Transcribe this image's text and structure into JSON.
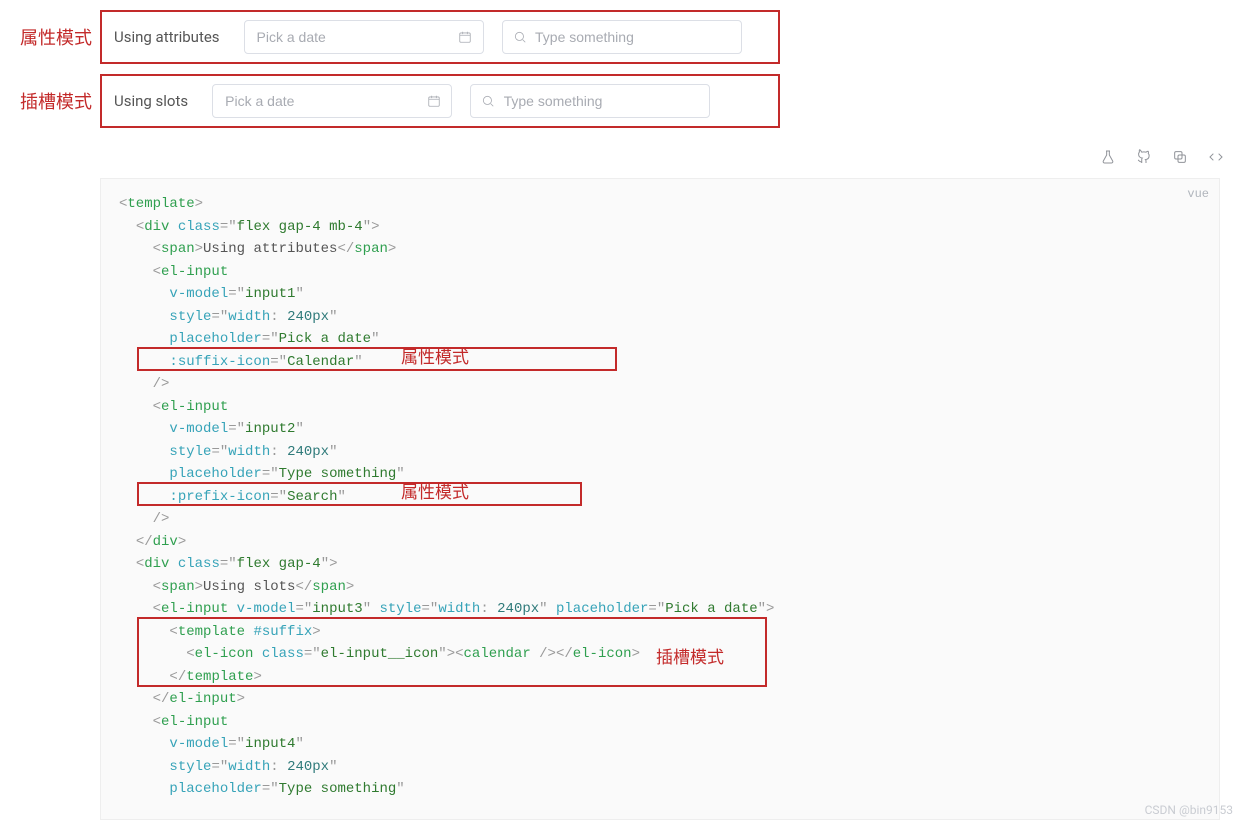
{
  "demo": {
    "row1": {
      "cn_label": "属性模式",
      "en_label": "Using attributes",
      "input1_placeholder": "Pick a date",
      "input2_placeholder": "Type something"
    },
    "row2": {
      "cn_label": "插槽模式",
      "en_label": "Using slots",
      "input1_placeholder": "Pick a date",
      "input2_placeholder": "Type something"
    }
  },
  "toolbar": {
    "lang_label": "vue"
  },
  "annotations": {
    "attr_mode_1": "属性模式",
    "attr_mode_2": "属性模式",
    "slot_mode": "插槽模式"
  },
  "watermark": "CSDN @bin9153",
  "code_lines": [
    {
      "indent": 0,
      "tokens": [
        {
          "c": "p",
          "v": "<"
        },
        {
          "c": "t",
          "v": "template"
        },
        {
          "c": "p",
          "v": ">"
        }
      ]
    },
    {
      "indent": 1,
      "tokens": [
        {
          "c": "p",
          "v": "<"
        },
        {
          "c": "t",
          "v": "div"
        },
        {
          "c": "p",
          "v": " "
        },
        {
          "c": "a",
          "v": "class"
        },
        {
          "c": "p",
          "v": "="
        },
        {
          "c": "p",
          "v": "\""
        },
        {
          "c": "s",
          "v": "flex gap-4 mb-4"
        },
        {
          "c": "p",
          "v": "\""
        },
        {
          "c": "p",
          "v": ">"
        }
      ]
    },
    {
      "indent": 2,
      "tokens": [
        {
          "c": "p",
          "v": "<"
        },
        {
          "c": "t",
          "v": "span"
        },
        {
          "c": "p",
          "v": ">"
        },
        {
          "c": "tx",
          "v": "Using attributes"
        },
        {
          "c": "p",
          "v": "</"
        },
        {
          "c": "t",
          "v": "span"
        },
        {
          "c": "p",
          "v": ">"
        }
      ]
    },
    {
      "indent": 2,
      "tokens": [
        {
          "c": "p",
          "v": "<"
        },
        {
          "c": "t",
          "v": "el-input"
        }
      ]
    },
    {
      "indent": 3,
      "tokens": [
        {
          "c": "a",
          "v": "v-model"
        },
        {
          "c": "p",
          "v": "="
        },
        {
          "c": "p",
          "v": "\""
        },
        {
          "c": "s",
          "v": "input1"
        },
        {
          "c": "p",
          "v": "\""
        }
      ]
    },
    {
      "indent": 3,
      "tokens": [
        {
          "c": "a",
          "v": "style"
        },
        {
          "c": "p",
          "v": "="
        },
        {
          "c": "p",
          "v": "\""
        },
        {
          "c": "a",
          "v": "width"
        },
        {
          "c": "p",
          "v": ":"
        },
        {
          "c": "tx",
          "v": " "
        },
        {
          "c": "n",
          "v": "240px"
        },
        {
          "c": "p",
          "v": "\""
        }
      ]
    },
    {
      "indent": 3,
      "tokens": [
        {
          "c": "a",
          "v": "placeholder"
        },
        {
          "c": "p",
          "v": "="
        },
        {
          "c": "p",
          "v": "\""
        },
        {
          "c": "s",
          "v": "Pick a date"
        },
        {
          "c": "p",
          "v": "\""
        }
      ]
    },
    {
      "indent": 3,
      "tokens": [
        {
          "c": "a",
          "v": ":suffix-icon"
        },
        {
          "c": "p",
          "v": "="
        },
        {
          "c": "p",
          "v": "\""
        },
        {
          "c": "s",
          "v": "Calendar"
        },
        {
          "c": "p",
          "v": "\""
        }
      ]
    },
    {
      "indent": 2,
      "tokens": [
        {
          "c": "p",
          "v": "/>"
        }
      ]
    },
    {
      "indent": 2,
      "tokens": [
        {
          "c": "p",
          "v": "<"
        },
        {
          "c": "t",
          "v": "el-input"
        }
      ]
    },
    {
      "indent": 3,
      "tokens": [
        {
          "c": "a",
          "v": "v-model"
        },
        {
          "c": "p",
          "v": "="
        },
        {
          "c": "p",
          "v": "\""
        },
        {
          "c": "s",
          "v": "input2"
        },
        {
          "c": "p",
          "v": "\""
        }
      ]
    },
    {
      "indent": 3,
      "tokens": [
        {
          "c": "a",
          "v": "style"
        },
        {
          "c": "p",
          "v": "="
        },
        {
          "c": "p",
          "v": "\""
        },
        {
          "c": "a",
          "v": "width"
        },
        {
          "c": "p",
          "v": ":"
        },
        {
          "c": "tx",
          "v": " "
        },
        {
          "c": "n",
          "v": "240px"
        },
        {
          "c": "p",
          "v": "\""
        }
      ]
    },
    {
      "indent": 3,
      "tokens": [
        {
          "c": "a",
          "v": "placeholder"
        },
        {
          "c": "p",
          "v": "="
        },
        {
          "c": "p",
          "v": "\""
        },
        {
          "c": "s",
          "v": "Type something"
        },
        {
          "c": "p",
          "v": "\""
        }
      ]
    },
    {
      "indent": 3,
      "tokens": [
        {
          "c": "a",
          "v": ":prefix-icon"
        },
        {
          "c": "p",
          "v": "="
        },
        {
          "c": "p",
          "v": "\""
        },
        {
          "c": "s",
          "v": "Search"
        },
        {
          "c": "p",
          "v": "\""
        }
      ]
    },
    {
      "indent": 2,
      "tokens": [
        {
          "c": "p",
          "v": "/>"
        }
      ]
    },
    {
      "indent": 1,
      "tokens": [
        {
          "c": "p",
          "v": "</"
        },
        {
          "c": "t",
          "v": "div"
        },
        {
          "c": "p",
          "v": ">"
        }
      ]
    },
    {
      "indent": 1,
      "tokens": [
        {
          "c": "p",
          "v": "<"
        },
        {
          "c": "t",
          "v": "div"
        },
        {
          "c": "p",
          "v": " "
        },
        {
          "c": "a",
          "v": "class"
        },
        {
          "c": "p",
          "v": "="
        },
        {
          "c": "p",
          "v": "\""
        },
        {
          "c": "s",
          "v": "flex gap-4"
        },
        {
          "c": "p",
          "v": "\""
        },
        {
          "c": "p",
          "v": ">"
        }
      ]
    },
    {
      "indent": 2,
      "tokens": [
        {
          "c": "p",
          "v": "<"
        },
        {
          "c": "t",
          "v": "span"
        },
        {
          "c": "p",
          "v": ">"
        },
        {
          "c": "tx",
          "v": "Using slots"
        },
        {
          "c": "p",
          "v": "</"
        },
        {
          "c": "t",
          "v": "span"
        },
        {
          "c": "p",
          "v": ">"
        }
      ]
    },
    {
      "indent": 2,
      "tokens": [
        {
          "c": "p",
          "v": "<"
        },
        {
          "c": "t",
          "v": "el-input"
        },
        {
          "c": "p",
          "v": " "
        },
        {
          "c": "a",
          "v": "v-model"
        },
        {
          "c": "p",
          "v": "="
        },
        {
          "c": "p",
          "v": "\""
        },
        {
          "c": "s",
          "v": "input3"
        },
        {
          "c": "p",
          "v": "\""
        },
        {
          "c": "p",
          "v": " "
        },
        {
          "c": "a",
          "v": "style"
        },
        {
          "c": "p",
          "v": "="
        },
        {
          "c": "p",
          "v": "\""
        },
        {
          "c": "a",
          "v": "width"
        },
        {
          "c": "p",
          "v": ":"
        },
        {
          "c": "tx",
          "v": " "
        },
        {
          "c": "n",
          "v": "240px"
        },
        {
          "c": "p",
          "v": "\""
        },
        {
          "c": "p",
          "v": " "
        },
        {
          "c": "a",
          "v": "placeholder"
        },
        {
          "c": "p",
          "v": "="
        },
        {
          "c": "p",
          "v": "\""
        },
        {
          "c": "s",
          "v": "Pick a date"
        },
        {
          "c": "p",
          "v": "\""
        },
        {
          "c": "p",
          "v": ">"
        }
      ]
    },
    {
      "indent": 3,
      "tokens": [
        {
          "c": "p",
          "v": "<"
        },
        {
          "c": "t",
          "v": "template"
        },
        {
          "c": "p",
          "v": " "
        },
        {
          "c": "a",
          "v": "#suffix"
        },
        {
          "c": "p",
          "v": ">"
        }
      ]
    },
    {
      "indent": 4,
      "tokens": [
        {
          "c": "p",
          "v": "<"
        },
        {
          "c": "t",
          "v": "el-icon"
        },
        {
          "c": "p",
          "v": " "
        },
        {
          "c": "a",
          "v": "class"
        },
        {
          "c": "p",
          "v": "="
        },
        {
          "c": "p",
          "v": "\""
        },
        {
          "c": "s",
          "v": "el-input__icon"
        },
        {
          "c": "p",
          "v": "\""
        },
        {
          "c": "p",
          "v": "><"
        },
        {
          "c": "t",
          "v": "calendar"
        },
        {
          "c": "p",
          "v": " /></"
        },
        {
          "c": "t",
          "v": "el-icon"
        },
        {
          "c": "p",
          "v": ">"
        }
      ]
    },
    {
      "indent": 3,
      "tokens": [
        {
          "c": "p",
          "v": "</"
        },
        {
          "c": "t",
          "v": "template"
        },
        {
          "c": "p",
          "v": ">"
        }
      ]
    },
    {
      "indent": 2,
      "tokens": [
        {
          "c": "p",
          "v": "</"
        },
        {
          "c": "t",
          "v": "el-input"
        },
        {
          "c": "p",
          "v": ">"
        }
      ]
    },
    {
      "indent": 2,
      "tokens": [
        {
          "c": "p",
          "v": "<"
        },
        {
          "c": "t",
          "v": "el-input"
        }
      ]
    },
    {
      "indent": 3,
      "tokens": [
        {
          "c": "a",
          "v": "v-model"
        },
        {
          "c": "p",
          "v": "="
        },
        {
          "c": "p",
          "v": "\""
        },
        {
          "c": "s",
          "v": "input4"
        },
        {
          "c": "p",
          "v": "\""
        }
      ]
    },
    {
      "indent": 3,
      "tokens": [
        {
          "c": "a",
          "v": "style"
        },
        {
          "c": "p",
          "v": "="
        },
        {
          "c": "p",
          "v": "\""
        },
        {
          "c": "a",
          "v": "width"
        },
        {
          "c": "p",
          "v": ":"
        },
        {
          "c": "tx",
          "v": " "
        },
        {
          "c": "n",
          "v": "240px"
        },
        {
          "c": "p",
          "v": "\""
        }
      ]
    },
    {
      "indent": 3,
      "tokens": [
        {
          "c": "a",
          "v": "placeholder"
        },
        {
          "c": "p",
          "v": "="
        },
        {
          "c": "p",
          "v": "\""
        },
        {
          "c": "s",
          "v": "Type something"
        },
        {
          "c": "p",
          "v": "\""
        }
      ]
    }
  ]
}
